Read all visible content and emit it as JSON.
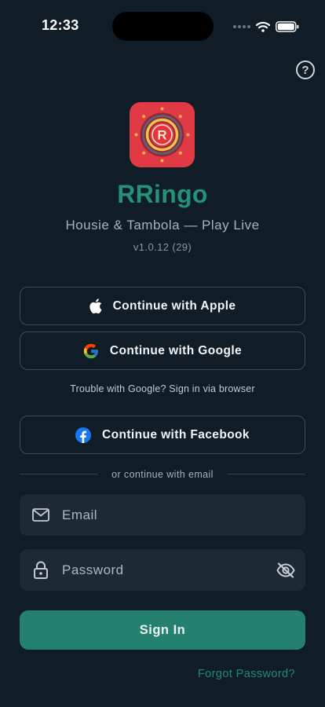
{
  "status_bar": {
    "time": "12:33"
  },
  "header": {
    "help_icon": "question-circle-icon"
  },
  "app": {
    "logo_letter": "R",
    "title": "RRingo",
    "subtitle": "Housie & Tambola — Play Live",
    "version": "v1.0.12 (29)"
  },
  "auth": {
    "apple_label": "Continue with Apple",
    "google_label": "Continue with Google",
    "google_trouble": "Trouble with Google? Sign in via browser",
    "facebook_label": "Continue with Facebook",
    "divider": "or continue with email"
  },
  "form": {
    "email_placeholder": "Email",
    "password_placeholder": "Password",
    "signin_label": "Sign In",
    "forgot_label": "Forgot Password?"
  },
  "colors": {
    "background": "#101c26",
    "accent": "#249179",
    "button": "#248170",
    "logo": "#e23a45"
  }
}
